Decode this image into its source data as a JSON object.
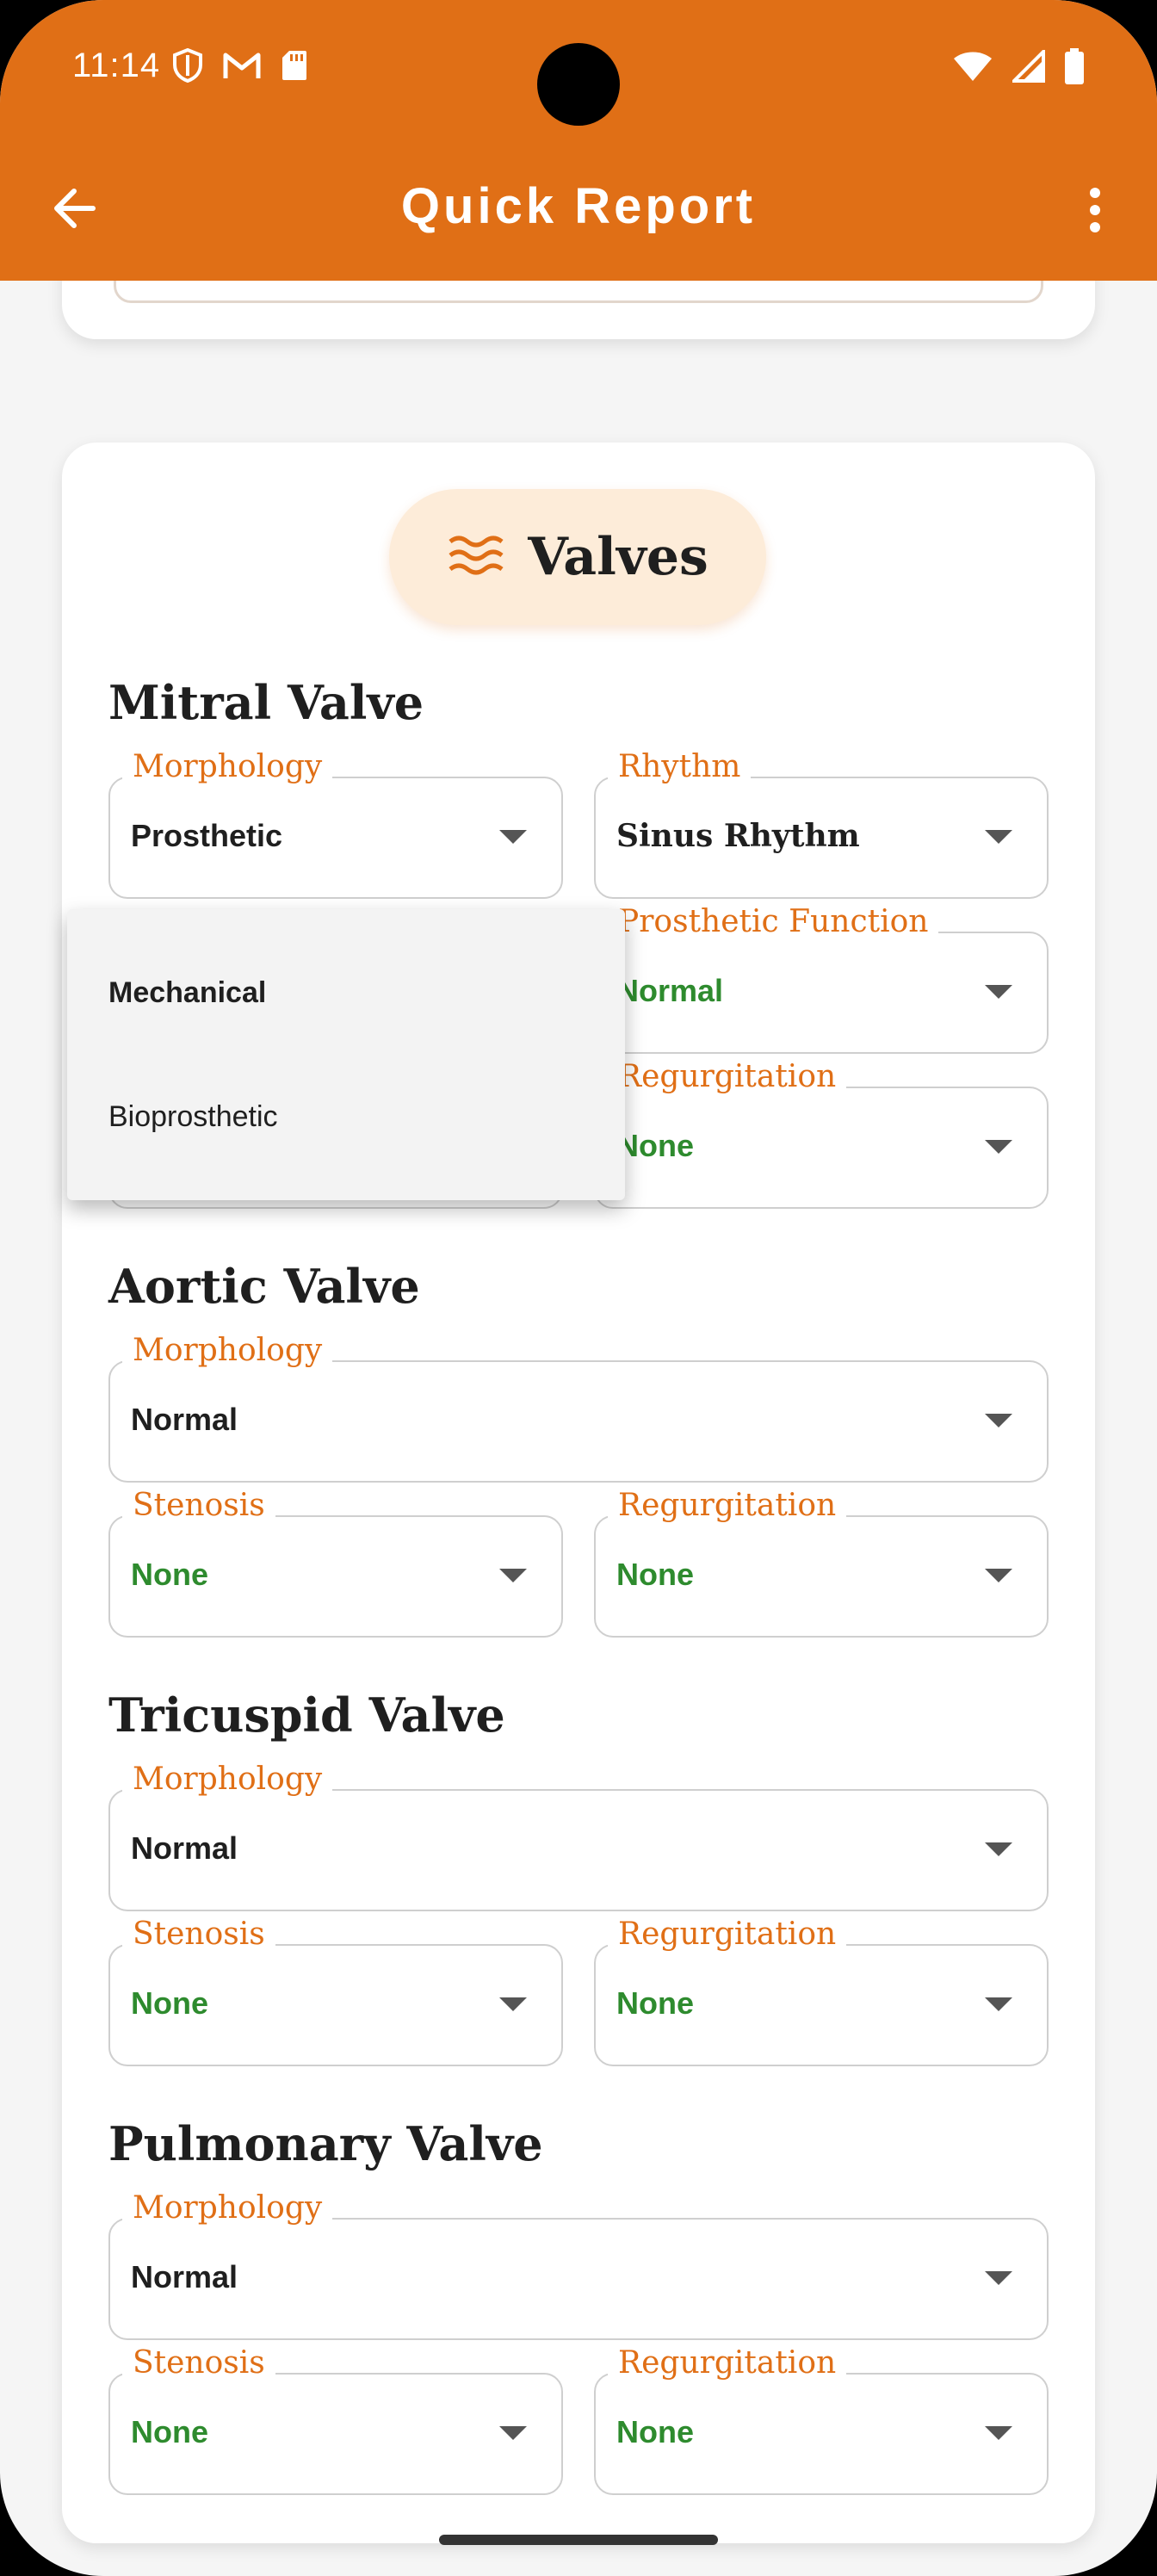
{
  "status_bar": {
    "time": "11:14",
    "left_icons": [
      "shield-icon",
      "gmail-icon",
      "sd-card-icon"
    ],
    "right_icons": [
      "wifi-icon",
      "signal-icon",
      "battery-icon"
    ]
  },
  "app_bar": {
    "title": "Quick Report",
    "back_icon": "arrow-back-icon",
    "menu_icon": "more-vert-icon",
    "color": "#e06f16"
  },
  "section": {
    "title": "Valves",
    "icon": "waves-icon",
    "accent": "#e06f16"
  },
  "mitral": {
    "title": "Mitral Valve",
    "morphology": {
      "label": "Morphology",
      "value": "Prosthetic"
    },
    "rhythm": {
      "label": "Rhythm",
      "value": "Sinus Rhythm"
    },
    "prosthetic_function": {
      "label": "Prosthetic Function",
      "value": "Normal"
    },
    "regurgitation": {
      "label": "Regurgitation",
      "value": "None"
    }
  },
  "dropdown": {
    "options": [
      "Mechanical",
      "Bioprosthetic"
    ],
    "selected": "Mechanical"
  },
  "aortic": {
    "title": "Aortic Valve",
    "morphology": {
      "label": "Morphology",
      "value": "Normal"
    },
    "stenosis": {
      "label": "Stenosis",
      "value": "None"
    },
    "regurgitation": {
      "label": "Regurgitation",
      "value": "None"
    }
  },
  "tricuspid": {
    "title": "Tricuspid Valve",
    "morphology": {
      "label": "Morphology",
      "value": "Normal"
    },
    "stenosis": {
      "label": "Stenosis",
      "value": "None"
    },
    "regurgitation": {
      "label": "Regurgitation",
      "value": "None"
    }
  },
  "pulmonary": {
    "title": "Pulmonary Valve",
    "morphology": {
      "label": "Morphology",
      "value": "Normal"
    },
    "stenosis": {
      "label": "Stenosis",
      "value": "None"
    },
    "regurgitation": {
      "label": "Regurgitation",
      "value": "None"
    }
  },
  "colors": {
    "ok_value": "#2e8b2e",
    "label": "#e06f16"
  }
}
